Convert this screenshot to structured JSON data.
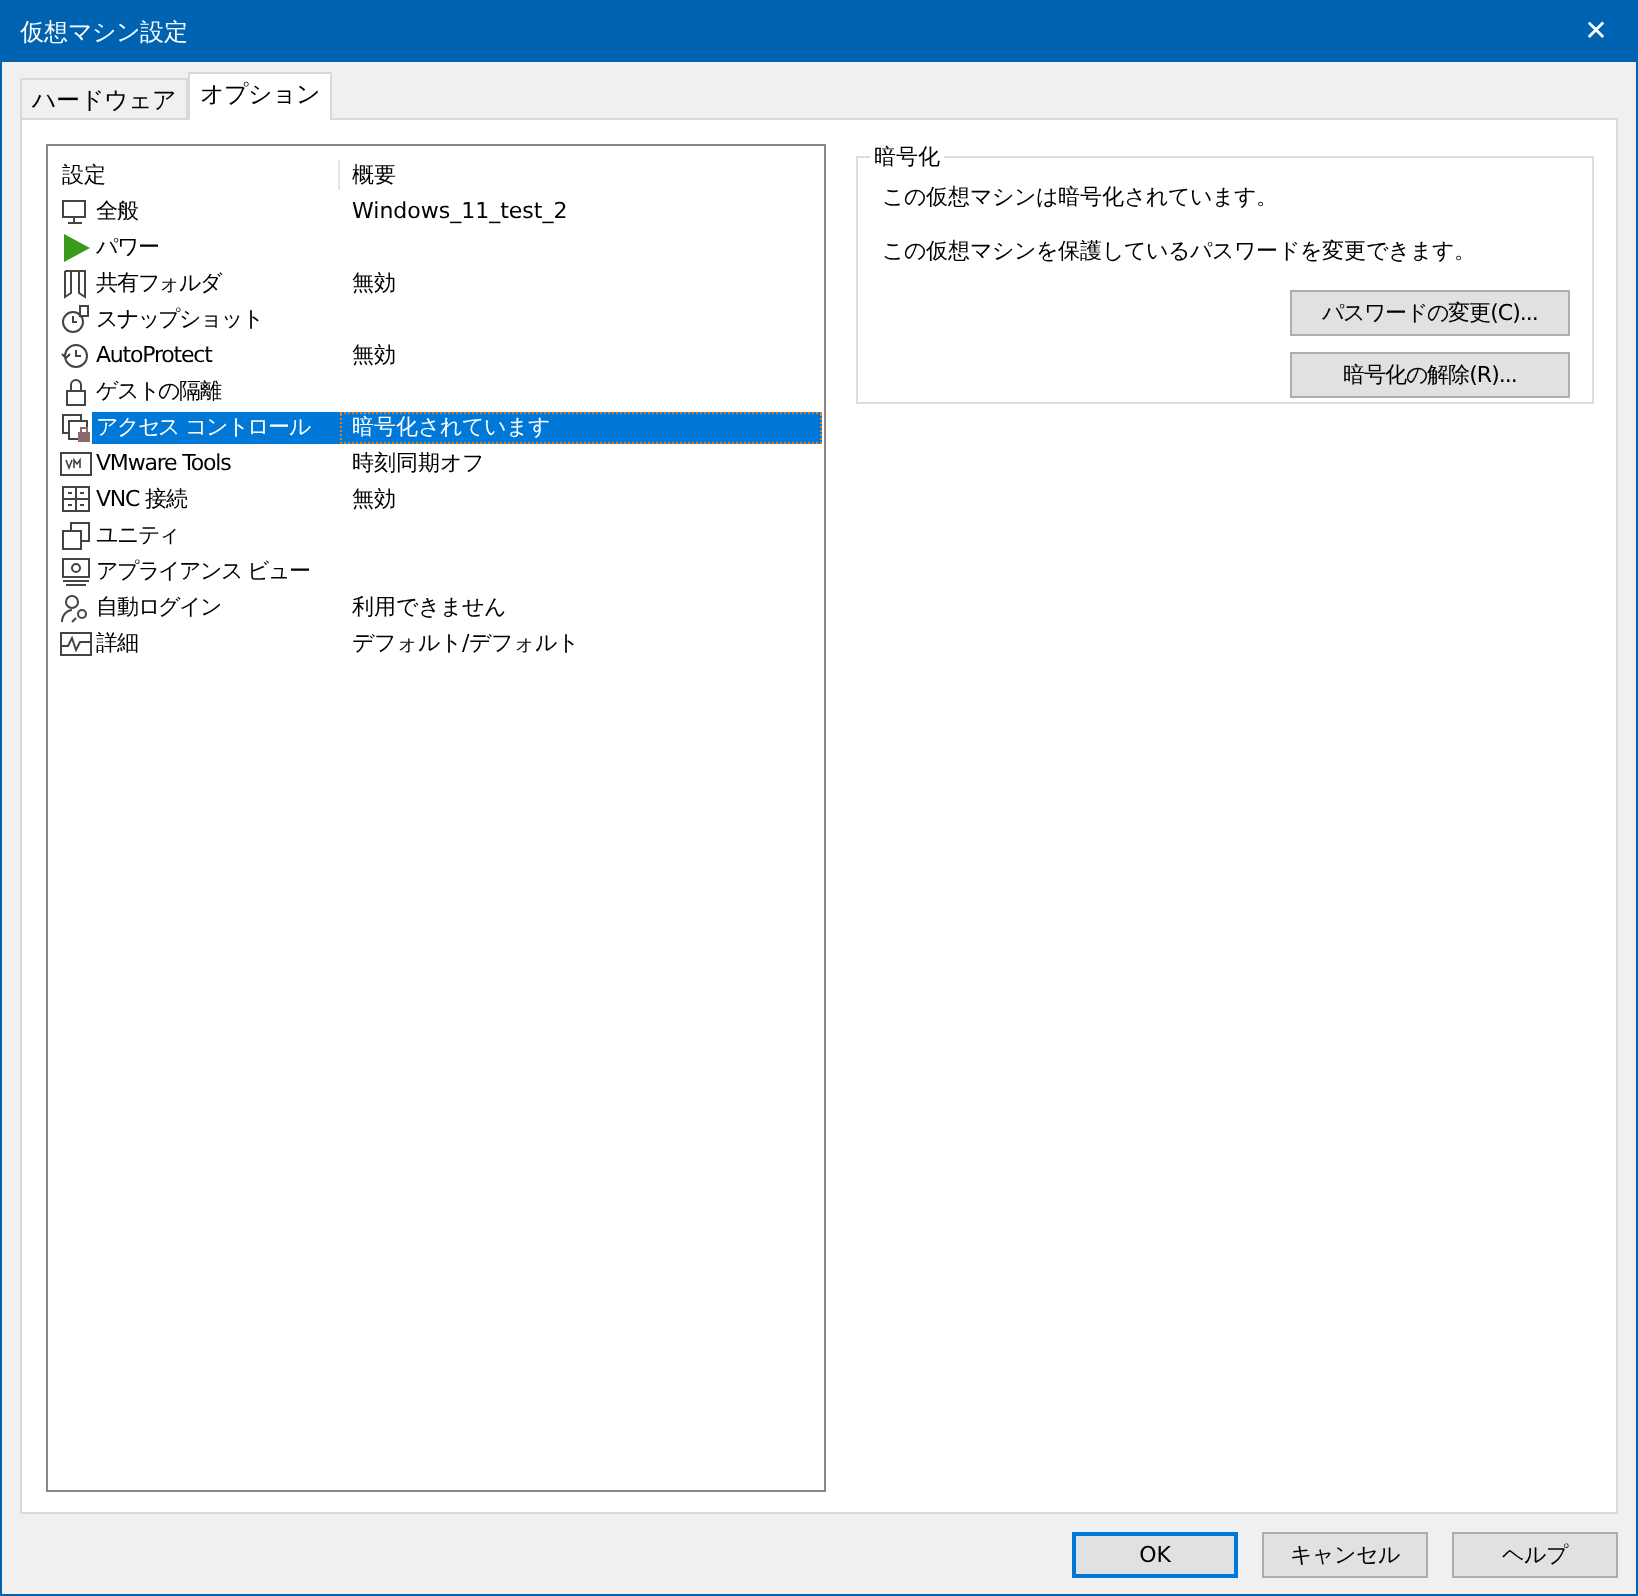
{
  "window": {
    "title": "仮想マシン設定",
    "close": "✕"
  },
  "tabs": [
    {
      "label": "ハードウェア",
      "selected": false
    },
    {
      "label": "オプション",
      "selected": true
    }
  ],
  "settings_list": {
    "columns": [
      "設定",
      "概要"
    ],
    "rows": [
      {
        "name": "全般",
        "summary": "Windows_11_test_2",
        "selected": false
      },
      {
        "name": "パワー",
        "summary": "",
        "selected": false
      },
      {
        "name": "共有フォルダ",
        "summary": "無効",
        "selected": false
      },
      {
        "name": "スナップショット",
        "summary": "",
        "selected": false
      },
      {
        "name": "AutoProtect",
        "summary": "無効",
        "selected": false
      },
      {
        "name": "ゲストの隔離",
        "summary": "",
        "selected": false
      },
      {
        "name": "アクセス コントロール",
        "summary": "暗号化されています",
        "selected": true
      },
      {
        "name": "VMware Tools",
        "summary": "時刻同期オフ",
        "selected": false
      },
      {
        "name": "VNC 接続",
        "summary": "無効",
        "selected": false
      },
      {
        "name": "ユニティ",
        "summary": "",
        "selected": false
      },
      {
        "name": "アプライアンス ビュー",
        "summary": "",
        "selected": false
      },
      {
        "name": "自動ログイン",
        "summary": "利用できません",
        "selected": false
      },
      {
        "name": "詳細",
        "summary": "デフォルト/デフォルト",
        "selected": false
      }
    ]
  },
  "encryption": {
    "title": "暗号化",
    "status": "この仮想マシンは暗号化されています。",
    "info": "この仮想マシンを保護しているパスワードを変更できます。",
    "buttons": [
      "パスワードの変更(C)...",
      "暗号化の解除(R)..."
    ]
  },
  "footer_buttons": [
    {
      "label": "OK",
      "default": true
    },
    {
      "label": "キャンセル",
      "default": false
    },
    {
      "label": "ヘルプ",
      "default": false
    }
  ]
}
